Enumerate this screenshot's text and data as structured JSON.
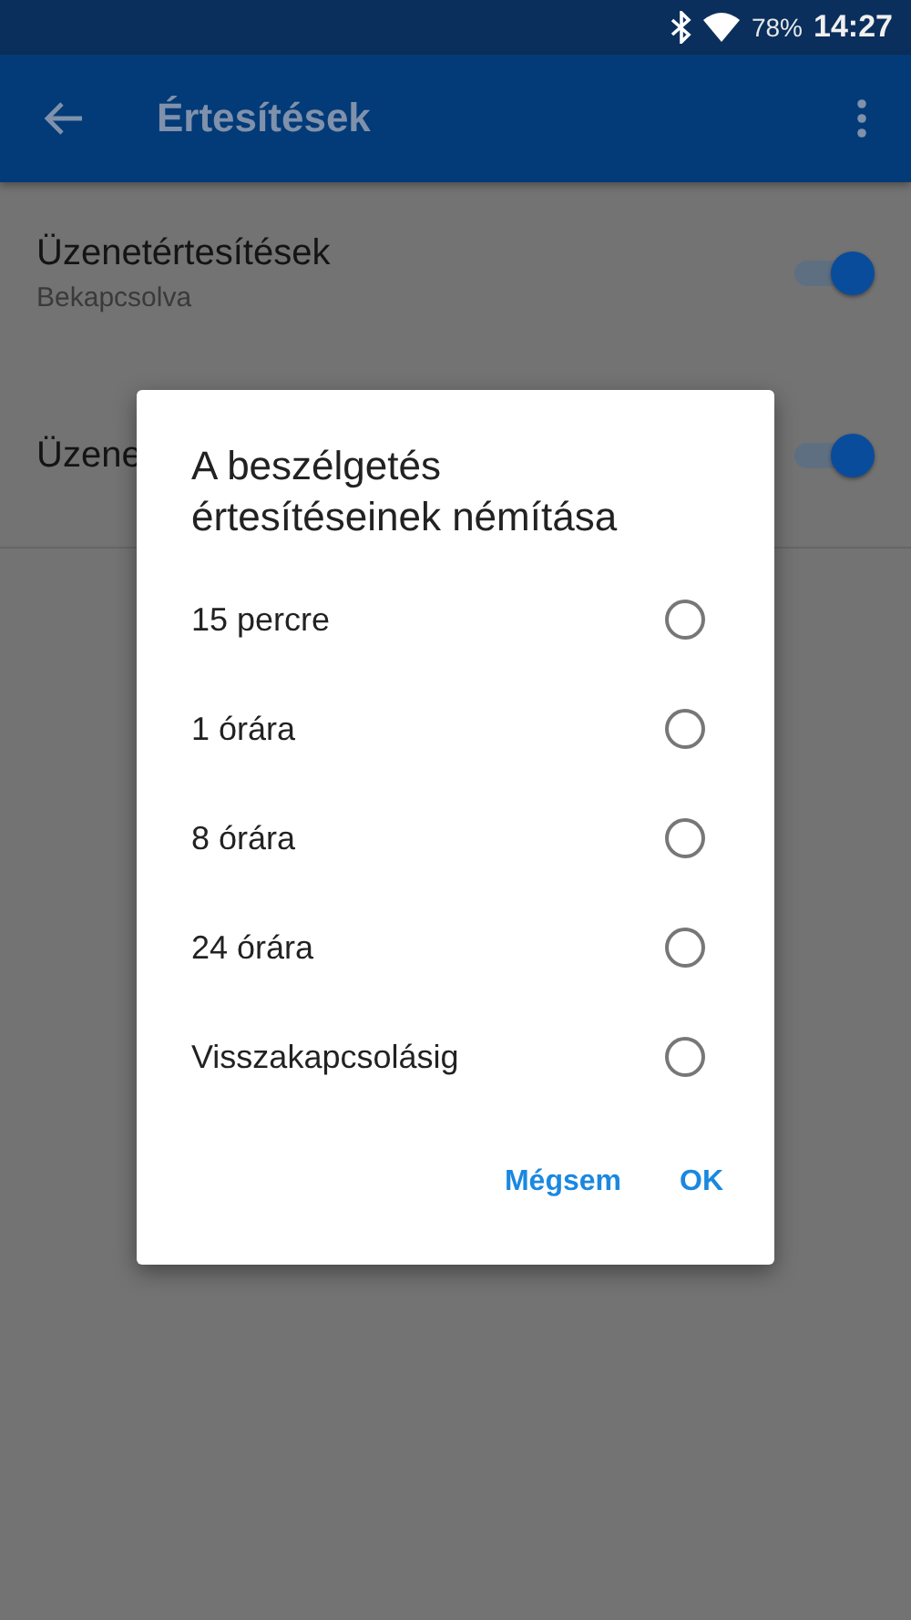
{
  "status_bar": {
    "battery": "78%",
    "time": "14:27"
  },
  "app_bar": {
    "title": "Értesítések"
  },
  "settings": [
    {
      "title": "Üzenetértesítések",
      "subtitle": "Bekapcsolva",
      "on": true
    },
    {
      "title": "Üzene",
      "on": true
    }
  ],
  "dialog": {
    "title": "A beszélgetés értesítéseinek némítása",
    "options": [
      {
        "label": "15 percre",
        "selected": false
      },
      {
        "label": "1 órára",
        "selected": false
      },
      {
        "label": "8 órára",
        "selected": false
      },
      {
        "label": "24 órára",
        "selected": false
      },
      {
        "label": "Visszakapcsolásig",
        "selected": false
      }
    ],
    "buttons": [
      "Mégsem",
      "OK"
    ]
  }
}
